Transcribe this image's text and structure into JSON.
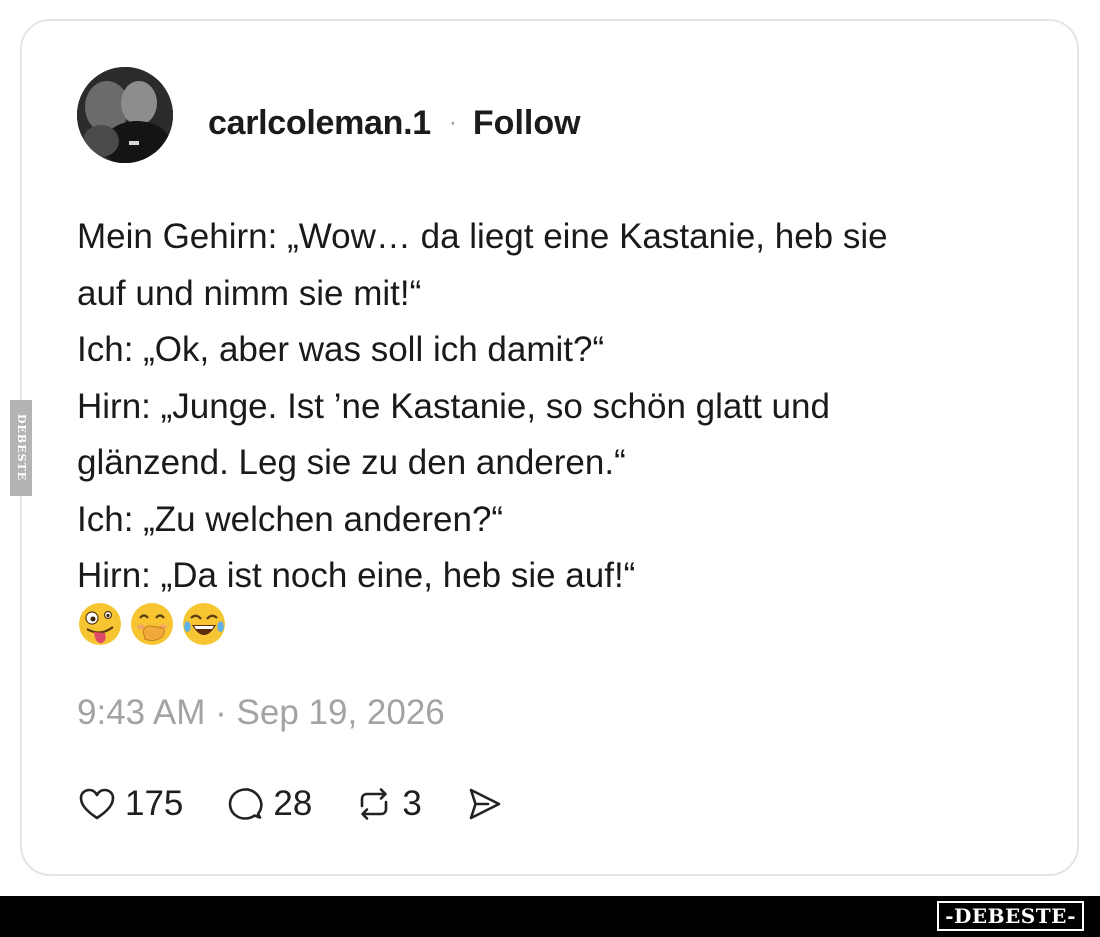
{
  "post": {
    "username": "carlcoleman.1",
    "separator": "·",
    "follow_label": "Follow",
    "lines": [
      "Mein Gehirn: „Wow… da liegt eine Kastanie, heb sie",
      "auf und nimm sie mit!“",
      "Ich: „Ok, aber was soll ich damit?“",
      "Hirn: „Junge. Ist ’ne Kastanie, so schön glatt und",
      "glänzend. Leg sie zu den anderen.“",
      "Ich: „Zu welchen anderen?“",
      "Hirn: „Da ist noch eine, heb sie auf!“"
    ],
    "emojis": [
      "zany-face",
      "hand-over-mouth-face",
      "tears-of-joy-face"
    ],
    "timestamp": "9:43 AM · Sep 19, 2026"
  },
  "actions": {
    "likes": "175",
    "replies": "28",
    "reposts": "3",
    "icons": [
      "heart-icon",
      "reply-bubble-icon",
      "repost-icon",
      "share-send-icon"
    ]
  },
  "watermark": {
    "side": "DEBESTE",
    "footer": "-DEBESTE-"
  },
  "colors": {
    "card_border": "#e4e4e4",
    "text": "#1a1a1a",
    "timestamp": "#a3a3a3",
    "footer_bar": "#000000",
    "emoji_yellow": "#f7c531"
  }
}
